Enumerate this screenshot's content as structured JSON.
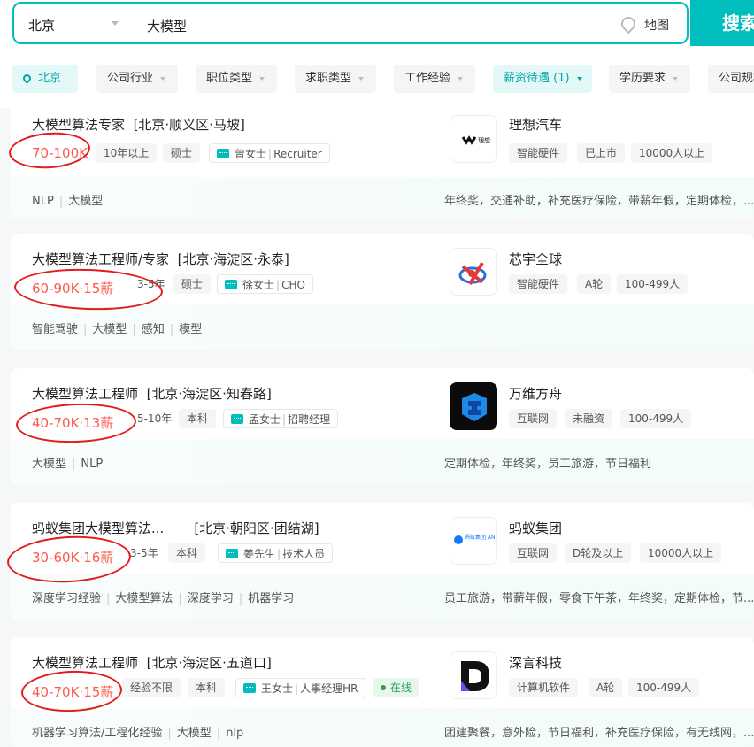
{
  "search": {
    "city": "北京",
    "query": "大模型",
    "map_label": "地图",
    "button_label": "搜索"
  },
  "filters": [
    {
      "label": "北京",
      "active": true
    },
    {
      "label": "公司行业"
    },
    {
      "label": "职位类型"
    },
    {
      "label": "求职类型"
    },
    {
      "label": "工作经验"
    },
    {
      "label": "薪资待遇 (1)",
      "active": true
    },
    {
      "label": "学历要求"
    },
    {
      "label": "公司规模"
    }
  ],
  "jobs": [
    {
      "title": "大模型算法专家",
      "location": "[北京·顺义区·马坡]",
      "salary": "70-100K",
      "experience": "10年以上",
      "education": "硕士",
      "recruiter": "曾女士",
      "recruiter_role": "Recruiter",
      "skills": [
        "NLP",
        "大模型"
      ],
      "company": "理想汽车",
      "company_tags": [
        "智能硬件",
        "已上市",
        "10000人以上"
      ],
      "benefits": "年终奖，交通补助，补充医疗保险，带薪年假，定期体检，..."
    },
    {
      "title": "大模型算法工程师/专家",
      "location": "[北京·海淀区·永泰]",
      "salary": "60-90K·15薪",
      "experience": "3-5年",
      "education": "硕士",
      "recruiter": "徐女士",
      "recruiter_role": "CHO",
      "skills": [
        "智能驾驶",
        "大模型",
        "感知",
        "模型"
      ],
      "company": "芯宇全球",
      "company_tags": [
        "智能硬件",
        "A轮",
        "100-499人"
      ],
      "benefits": ""
    },
    {
      "title": "大模型算法工程师",
      "location": "[北京·海淀区·知春路]",
      "salary": "40-70K·13薪",
      "experience": "5-10年",
      "education": "本科",
      "recruiter": "孟女士",
      "recruiter_role": "招聘经理",
      "skills": [
        "大模型",
        "NLP"
      ],
      "company": "万维方舟",
      "company_tags": [
        "互联网",
        "未融资",
        "100-499人"
      ],
      "benefits": "定期体检，年终奖，员工旅游，节日福利"
    },
    {
      "title": "蚂蚁集团大模型算法...",
      "location": "[北京·朝阳区·团结湖]",
      "salary": "30-60K·16薪",
      "experience": "3-5年",
      "education": "本科",
      "recruiter": "姜先生",
      "recruiter_role": "技术人员",
      "skills": [
        "深度学习经验",
        "大模型算法",
        "深度学习",
        "机器学习"
      ],
      "company": "蚂蚁集团",
      "company_tags": [
        "互联网",
        "D轮及以上",
        "10000人以上"
      ],
      "benefits": "员工旅游，带薪年假，零食下午茶，年终奖，定期体检，节..."
    },
    {
      "title": "大模型算法工程师",
      "location": "[北京·海淀区·五道口]",
      "salary": "40-70K·15薪",
      "experience": "经验不限",
      "education": "本科",
      "recruiter": "王女士",
      "recruiter_role": "人事经理HR",
      "online": "在线",
      "skills": [
        "机器学习算法/工程化经验",
        "大模型",
        "nlp"
      ],
      "company": "深言科技",
      "company_tags": [
        "计算机软件",
        "A轮",
        "100-499人"
      ],
      "benefits": "团建聚餐，意外险，节日福利，补充医疗保险，有无线网，..."
    }
  ],
  "logos": {
    "0": "理想",
    "3": "蚂蚁集团 ANT GROUP"
  },
  "colors": {
    "accent": "#00bebd",
    "salary": "#fe574a",
    "annotation": "#e21b1b"
  }
}
